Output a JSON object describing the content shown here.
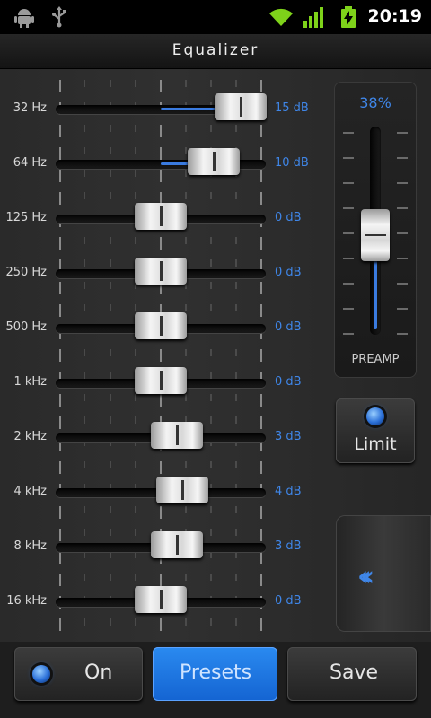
{
  "status_bar": {
    "time": "20:19",
    "icons": [
      "android-debug-icon",
      "usb-icon",
      "wifi-icon",
      "signal-bars-icon",
      "battery-charging-icon"
    ]
  },
  "header": {
    "title": "Equalizer"
  },
  "bands": [
    {
      "label": "32 Hz",
      "db": "15 dB",
      "gain": 15
    },
    {
      "label": "64 Hz",
      "db": "10 dB",
      "gain": 10
    },
    {
      "label": "125 Hz",
      "db": "0 dB",
      "gain": 0
    },
    {
      "label": "250 Hz",
      "db": "0 dB",
      "gain": 0
    },
    {
      "label": "500 Hz",
      "db": "0 dB",
      "gain": 0
    },
    {
      "label": "1 kHz",
      "db": "0 dB",
      "gain": 0
    },
    {
      "label": "2 kHz",
      "db": "3 dB",
      "gain": 3
    },
    {
      "label": "4 kHz",
      "db": "4 dB",
      "gain": 4
    },
    {
      "label": "8 kHz",
      "db": "3 dB",
      "gain": 3
    },
    {
      "label": "16 kHz",
      "db": "0 dB",
      "gain": 0
    }
  ],
  "preamp": {
    "value_text": "38%",
    "value": 0.38,
    "label": "PREAMP"
  },
  "limit": {
    "label": "Limit",
    "on": true
  },
  "sidebar_toggle": {
    "icon": "double-chevron-left-icon"
  },
  "bottom_bar": {
    "on_label": "On",
    "presets_label": "Presets",
    "save_label": "Save"
  },
  "colors": {
    "accent": "#3f86e8",
    "active_button": "#1e78e6"
  }
}
